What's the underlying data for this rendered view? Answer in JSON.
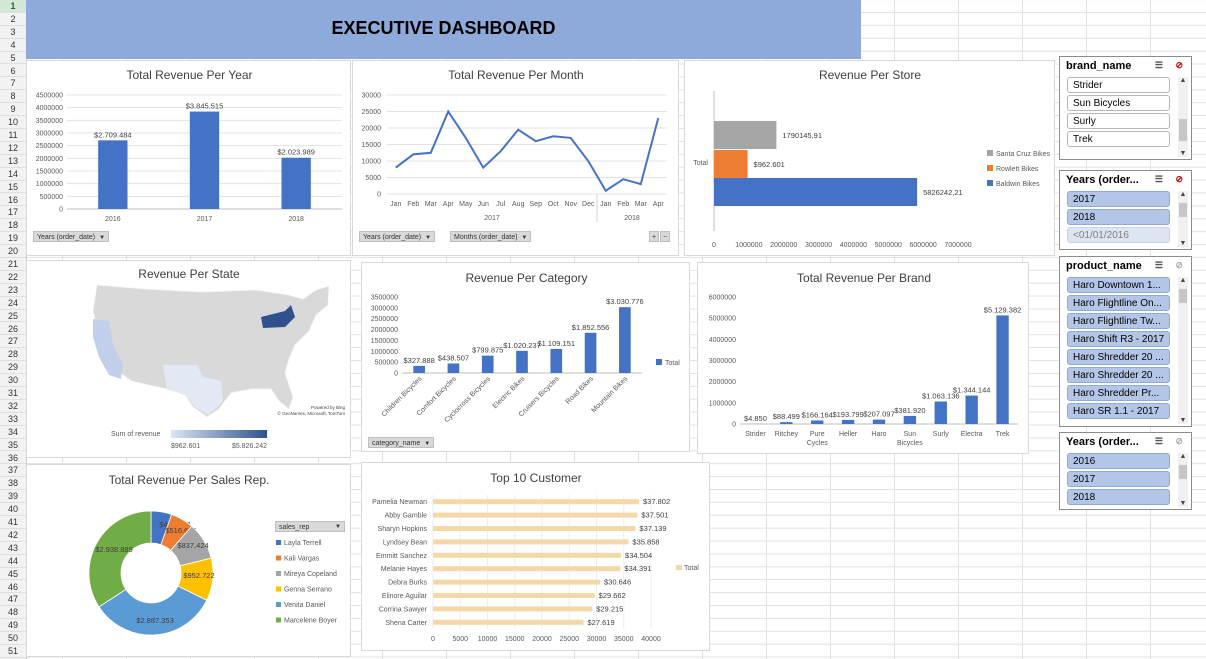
{
  "row_numbers": [
    "1",
    "2",
    "3",
    "4",
    "5",
    "6",
    "7",
    "8",
    "9",
    "10",
    "11",
    "12",
    "13",
    "14",
    "15",
    "16",
    "17",
    "18",
    "19",
    "20",
    "21",
    "22",
    "23",
    "24",
    "25",
    "26",
    "27",
    "28",
    "29",
    "30",
    "31",
    "32",
    "33",
    "34",
    "35",
    "36",
    "37",
    "38",
    "39",
    "40",
    "41",
    "42",
    "43",
    "44",
    "45",
    "46",
    "47",
    "48",
    "49",
    "50",
    "51"
  ],
  "dashboard_title": "EXECUTIVE DASHBOARD",
  "filter_buttons": {
    "years_order_date": "Years (order_date)",
    "months_order_date": "Months (order_date)",
    "category_name": "category_name",
    "sales_rep": "sales_rep"
  },
  "slicers": {
    "brand": {
      "title": "brand_name",
      "items": [
        "Strider",
        "Sun Bicycles",
        "Surly",
        "Trek"
      ]
    },
    "years1": {
      "title": "Years (order...",
      "items": [
        "2017",
        "2018",
        "<01/01/2016"
      ]
    },
    "product": {
      "title": "product_name",
      "items": [
        "Haro Downtown 1...",
        "Haro Flightline On...",
        "Haro Flightline Tw...",
        "Haro Shift R3 - 2017",
        "Haro Shredder 20 ...",
        "Haro Shredder 20 ...",
        "Haro Shredder Pr...",
        "Haro SR 1.1 - 2017"
      ]
    },
    "years2": {
      "title": "Years (order...",
      "items": [
        "2016",
        "2017",
        "2018"
      ]
    }
  },
  "colors": {
    "blue": "#4472c4",
    "orange": "#ed7d31",
    "gray": "#a5a5a5",
    "gold": "#ffc000",
    "lightblue": "#5b9bd5",
    "green": "#70ad47",
    "tan": "#f4d8a8"
  },
  "chart_data": [
    {
      "id": "year",
      "type": "bar",
      "title": "Total Revenue Per Year",
      "categories": [
        "2016",
        "2017",
        "2018"
      ],
      "values": [
        2709484,
        3845515,
        2023989
      ],
      "labels": [
        "$2.709.484",
        "$3.845.515",
        "$2.023.989"
      ],
      "ylim": [
        0,
        4500000
      ],
      "yticks": [
        "0",
        "500000",
        "1000000",
        "1500000",
        "2000000",
        "2500000",
        "3000000",
        "3500000",
        "4000000",
        "4500000"
      ],
      "grid": true
    },
    {
      "id": "month",
      "type": "line",
      "title": "Total Revenue Per Month",
      "categories": [
        "Jan",
        "Feb",
        "Mar",
        "Apr",
        "May",
        "Jun",
        "Jul",
        "Aug",
        "Sep",
        "Oct",
        "Nov",
        "Dec",
        "Jan",
        "Feb",
        "Mar",
        "Apr"
      ],
      "groups": [
        "2017",
        "2018"
      ],
      "values": [
        8000,
        12000,
        12500,
        25000,
        17000,
        8000,
        13000,
        19500,
        16000,
        17500,
        17000,
        10000,
        1000,
        4500,
        3000,
        23000
      ],
      "ylim": [
        0,
        30000
      ],
      "yticks": [
        "0",
        "5000",
        "10000",
        "15000",
        "20000",
        "25000",
        "30000"
      ],
      "grid": true
    },
    {
      "id": "store",
      "type": "bar",
      "orientation": "horizontal",
      "title": "Revenue Per Store",
      "category": "Total",
      "series": [
        {
          "name": "Santa Cruz Bikes",
          "value": 1790145.91,
          "label": "1790145,91"
        },
        {
          "name": "Rowlett Bikes",
          "value": 962601,
          "label": "$962.601"
        },
        {
          "name": "Baldwin Bikes",
          "value": 5826242.21,
          "label": "5826242,21"
        }
      ],
      "xlim": [
        0,
        7000000
      ],
      "xticks": [
        "0",
        "1000000",
        "2000000",
        "3000000",
        "4000000",
        "5000000",
        "6000000",
        "7000000"
      ],
      "legend": "right"
    },
    {
      "id": "state",
      "type": "map",
      "title": "Revenue Per State",
      "regions": [
        {
          "name": "California",
          "level": 0.25
        },
        {
          "name": "Texas",
          "level": 0.1
        },
        {
          "name": "New York",
          "level": 1.0
        }
      ],
      "legend_title": "Sum of revenue",
      "legend_min": "$962.601",
      "legend_max": "$5.826.242",
      "credit1": "Powered by Bing",
      "credit2": "© GeoNames, Microsoft, TomTom"
    },
    {
      "id": "category",
      "type": "bar",
      "title": "Revenue Per Category",
      "categories": [
        "Children Bicycles",
        "Comfort Bicycles",
        "Cyclocross Bicycles",
        "Electric Bikes",
        "Cruisers Bicycles",
        "Road Bikes",
        "Mountain Bikes"
      ],
      "values": [
        327888,
        438507,
        799875,
        1020237,
        1109151,
        1852556,
        3030776
      ],
      "labels": [
        "$327.888",
        "$438.507",
        "$799.875",
        "$1.020.237",
        "$1.109.151",
        "$1.852.556",
        "$3.030.776"
      ],
      "ylim": [
        0,
        3500000
      ],
      "yticks": [
        "0",
        "500000",
        "1000000",
        "1500000",
        "2000000",
        "2500000",
        "3000000",
        "3500000"
      ],
      "legend": "Total"
    },
    {
      "id": "brand",
      "type": "bar",
      "title": "Total Revenue Per Brand",
      "categories": [
        "Strider",
        "Ritchey",
        "Pure Cycles",
        "Heller",
        "Haro",
        "Sun Bicycles",
        "Surly",
        "Electra",
        "Trek"
      ],
      "values": [
        4850,
        88499,
        166164,
        193799,
        207097,
        381920,
        1063136,
        1344144,
        5129382
      ],
      "labels": [
        "$4.850",
        "$88.499",
        "$166.164",
        "$193.799",
        "$207.097",
        "$381.920",
        "$1.063.136",
        "$1.344.144",
        "$5.129.382"
      ],
      "ylim": [
        0,
        6000000
      ],
      "yticks": [
        "0",
        "1000000",
        "2000000",
        "3000000",
        "4000000",
        "5000000",
        "6000000"
      ]
    },
    {
      "id": "salesrep",
      "type": "pie",
      "title": "Total Revenue Per Sales Rep.",
      "series": [
        {
          "name": "Layla Terrell",
          "value": 463918,
          "label": "$463.918"
        },
        {
          "name": "Kali Vargas",
          "value": 516695,
          "label": "$516.695"
        },
        {
          "name": "Mireya Copeland",
          "value": 837424,
          "label": "$837.424"
        },
        {
          "name": "Genna Serrano",
          "value": 952722,
          "label": "$952.722"
        },
        {
          "name": "Venita Daniel",
          "value": 2887353,
          "label": "$2.887.353"
        },
        {
          "name": "Marcelene Boyer",
          "value": 2938889,
          "label": "$2.938.889"
        }
      ],
      "legend": "right"
    },
    {
      "id": "customer",
      "type": "bar",
      "orientation": "horizontal",
      "title": "Top 10 Customer",
      "categories": [
        "Pamelia Newman",
        "Abby Gamble",
        "Sharyn Hopkins",
        "Lyndsey Bean",
        "Emmitt Sanchez",
        "Melanie Hayes",
        "Debra Burks",
        "Elinore Aguilar",
        "Corrina Sawyer",
        "Shena Carter"
      ],
      "values": [
        37802,
        37501,
        37139,
        35858,
        34504,
        34391,
        30646,
        29662,
        29215,
        27619
      ],
      "labels": [
        "$37.802",
        "$37.501",
        "$37.139",
        "$35.858",
        "$34.504",
        "$34.391",
        "$30.646",
        "$29.662",
        "$29.215",
        "$27.619"
      ],
      "xlim": [
        0,
        40000
      ],
      "xticks": [
        "0",
        "5000",
        "10000",
        "15000",
        "20000",
        "25000",
        "30000",
        "35000",
        "40000"
      ],
      "legend": "Total"
    }
  ]
}
